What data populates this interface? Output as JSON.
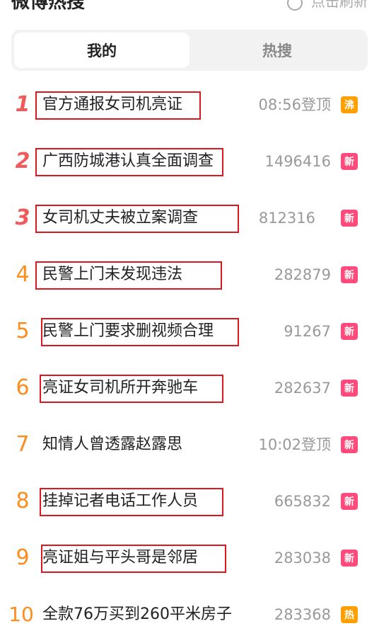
{
  "header": {
    "title": "微博热搜",
    "refresh_label": "点击刷新"
  },
  "tabs": [
    {
      "label": "我的"
    },
    {
      "label": "热搜"
    }
  ],
  "items": [
    {
      "rank": "1",
      "text": "官方通报女司机亮证",
      "value": "08:56登顶",
      "badge": "沸",
      "badge_color": "#ff9f00"
    },
    {
      "rank": "2",
      "text": "广西防城港认真全面调查",
      "value": "1496416",
      "badge": "新",
      "badge_color": "#ff4a7c"
    },
    {
      "rank": "3",
      "text": "女司机丈夫被立案调查",
      "value": "812316",
      "badge": "新",
      "badge_color": "#ff4a7c"
    },
    {
      "rank": "4",
      "text": "民警上门未发现违法",
      "value": "282879",
      "badge": "新",
      "badge_color": "#ff4a7c"
    },
    {
      "rank": "5",
      "text": "民警上门要求删视频合理",
      "value": "91267",
      "badge": "新",
      "badge_color": "#ff4a7c"
    },
    {
      "rank": "6",
      "text": "亮证女司机所开奔驰车",
      "value": "282637",
      "badge": "新",
      "badge_color": "#ff4a7c"
    },
    {
      "rank": "7",
      "text": "知情人曾透露赵露思",
      "value": "10:02登顶",
      "badge": "新",
      "badge_color": "#ff4a7c"
    },
    {
      "rank": "8",
      "text": "挂掉记者电话工作人员",
      "value": "665832",
      "badge": "新",
      "badge_color": "#ff4a7c"
    },
    {
      "rank": "9",
      "text": "亮证姐与平头哥是邻居",
      "value": "283038",
      "badge": "新",
      "badge_color": "#ff4a7c"
    },
    {
      "rank": "10",
      "text": "全款76万买到260平米房子",
      "value": "283368",
      "badge": "热",
      "badge_color": "#ff9f00"
    }
  ]
}
